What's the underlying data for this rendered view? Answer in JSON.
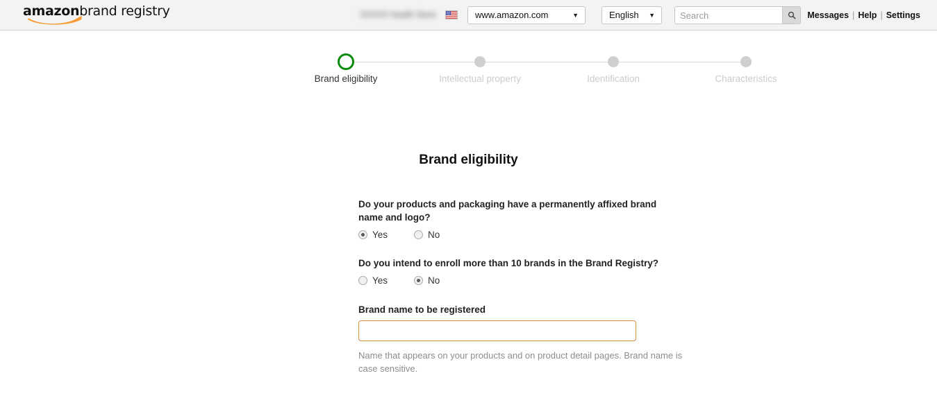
{
  "header": {
    "logo": {
      "amazon": "amazon",
      "suffix": "brand registry",
      "smile_icon": "amazon-smile-icon"
    },
    "store_name": "XXXXX Health Store",
    "flag_icon": "us-flag-icon",
    "domain_select": {
      "value": "www.amazon.com",
      "caret": "▼"
    },
    "language_select": {
      "value": "English",
      "caret": "▼"
    },
    "search": {
      "value": "",
      "placeholder": "Search",
      "icon": "search-icon"
    },
    "links": {
      "messages": "Messages",
      "help": "Help",
      "settings": "Settings",
      "separator": "|"
    }
  },
  "stepper": {
    "steps": [
      {
        "label": "Brand eligibility",
        "state": "active"
      },
      {
        "label": "Intellectual property",
        "state": "upcoming"
      },
      {
        "label": "Identification",
        "state": "upcoming"
      },
      {
        "label": "Characteristics",
        "state": "upcoming"
      }
    ],
    "active_color": "#0a8a0a",
    "inactive_color": "#cfcfcf"
  },
  "main": {
    "title": "Brand eligibility",
    "questions": [
      {
        "label": "Do your products and packaging have a permanently affixed brand name and logo?",
        "options": [
          {
            "label": "Yes",
            "checked": true
          },
          {
            "label": "No",
            "checked": false
          }
        ]
      },
      {
        "label": "Do you intend to enroll more than 10 brands in the Brand Registry?",
        "options": [
          {
            "label": "Yes",
            "checked": false
          },
          {
            "label": "No",
            "checked": true
          }
        ]
      }
    ],
    "brand_name_field": {
      "label": "Brand name to be registered",
      "value": "",
      "placeholder": "",
      "focus_color": "#d08b45",
      "help": "Name that appears on your products and on product detail pages. Brand name is case sensitive."
    }
  }
}
